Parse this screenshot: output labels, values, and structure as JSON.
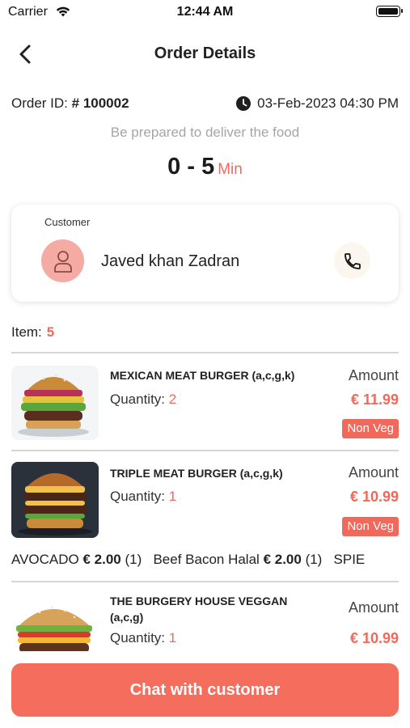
{
  "status_bar": {
    "carrier": "Carrier",
    "time": "12:44 AM"
  },
  "nav": {
    "title": "Order Details",
    "back_icon": "chevron-left-icon"
  },
  "order": {
    "id_label": "Order ID:",
    "id_value": "# 100002",
    "date": "03-Feb-2023 04:30 PM",
    "date_icon": "clock-icon",
    "prepare_text": "Be prepared to deliver the food",
    "time_range": "0 - 5",
    "time_unit": "Min"
  },
  "customer": {
    "label": "Customer",
    "name": "Javed khan Zadran",
    "avatar_icon": "user-icon",
    "call_icon": "phone-icon"
  },
  "items_summary": {
    "label": "Item:",
    "count": "5"
  },
  "items": [
    {
      "name": "MEXICAN MEAT BURGER (a,c,g,k)",
      "quantity_label": "Quantity:",
      "quantity": "2",
      "amount_label": "Amount",
      "amount": "€ 11.99",
      "badge": "Non Veg"
    },
    {
      "name": "TRIPLE MEAT BURGER  (a,c,g,k)",
      "quantity_label": "Quantity:",
      "quantity": "1",
      "amount_label": "Amount",
      "amount": "€ 10.99",
      "badge": "Non Veg",
      "addons": [
        {
          "name": "AVOCADO",
          "price": "€ 2.00",
          "qty": "(1)"
        },
        {
          "name": "Beef Bacon Halal",
          "price": "€ 2.00",
          "qty": "(1)"
        },
        {
          "name": "SPIE",
          "price": "",
          "qty": ""
        }
      ]
    },
    {
      "name": "THE BURGERY HOUSE VEGGAN (a,c,g)",
      "quantity_label": "Quantity:",
      "quantity": "1",
      "amount_label": "Amount",
      "amount": "€ 10.99"
    }
  ],
  "actions": {
    "chat_button": "Chat with customer"
  },
  "colors": {
    "accent": "#f0695a",
    "button": "#f46d5d",
    "avatar_bg": "#f5aaa4",
    "muted_text": "#a5a5a5"
  }
}
